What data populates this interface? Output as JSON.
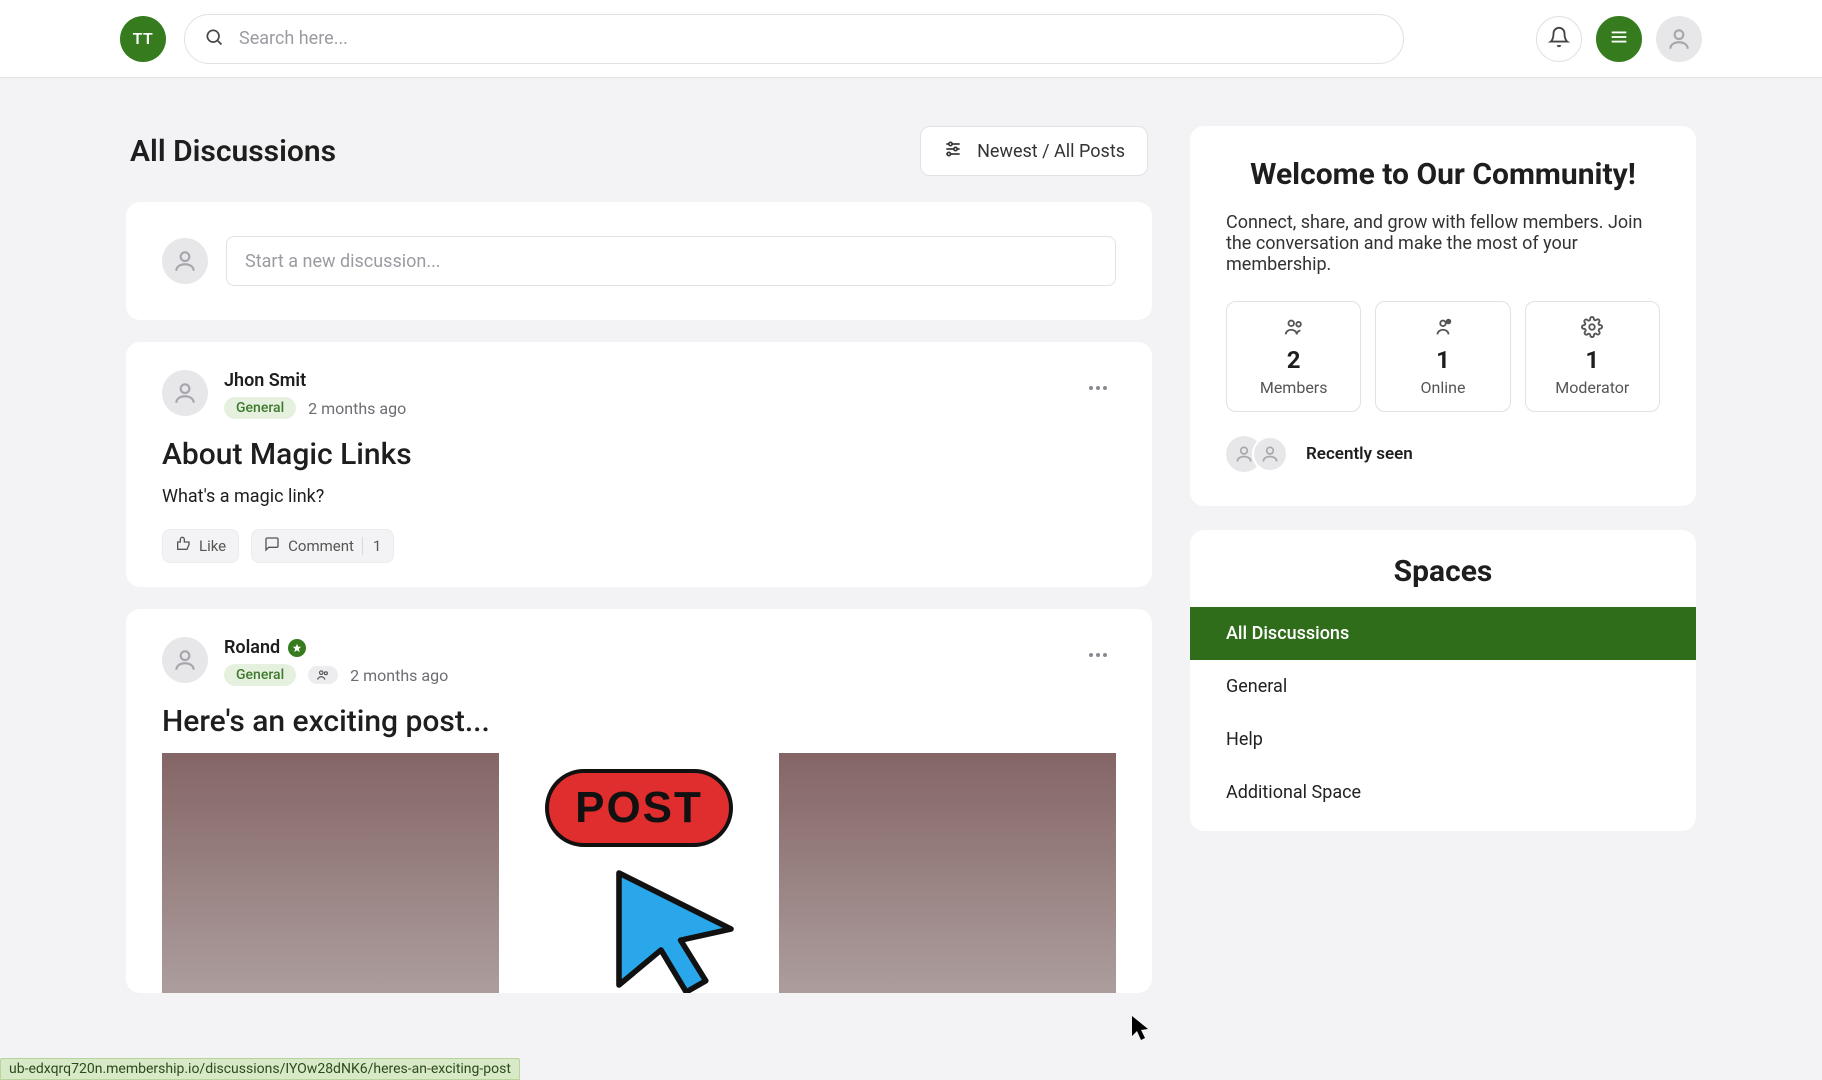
{
  "header": {
    "brand_initials": "TT",
    "search_placeholder": "Search here..."
  },
  "page_title": "All Discussions",
  "sort_label": "Newest / All Posts",
  "new_discussion_placeholder": "Start a new discussion...",
  "posts": [
    {
      "author": "Jhon Smit",
      "space": "General",
      "time": "2 months ago",
      "title": "About Magic Links",
      "body": "What's a magic link?",
      "like_label": "Like",
      "comment_label": "Comment",
      "comment_count": "1",
      "verified": false,
      "has_people_badge": false
    },
    {
      "author": "Roland",
      "space": "General",
      "time": "2 months ago",
      "title": "Here's an exciting post...",
      "verified": true,
      "has_people_badge": true,
      "image_label": "POST"
    }
  ],
  "welcome": {
    "title": "Welcome to Our Community!",
    "text": "Connect, share, and grow with fellow members. Join the conversation and make the most of your membership.",
    "stats": [
      {
        "count": "2",
        "label": "Members"
      },
      {
        "count": "1",
        "label": "Online"
      },
      {
        "count": "1",
        "label": "Moderator"
      }
    ],
    "recent_label": "Recently seen"
  },
  "spaces": {
    "title": "Spaces",
    "items": [
      {
        "label": "All Discussions",
        "active": true
      },
      {
        "label": "General",
        "active": false
      },
      {
        "label": "Help",
        "active": false
      },
      {
        "label": "Additional Space",
        "active": false
      }
    ]
  },
  "status_url": "ub-edxqrq720n.membership.io/discussions/IYOw28dNK6/heres-an-exciting-post"
}
